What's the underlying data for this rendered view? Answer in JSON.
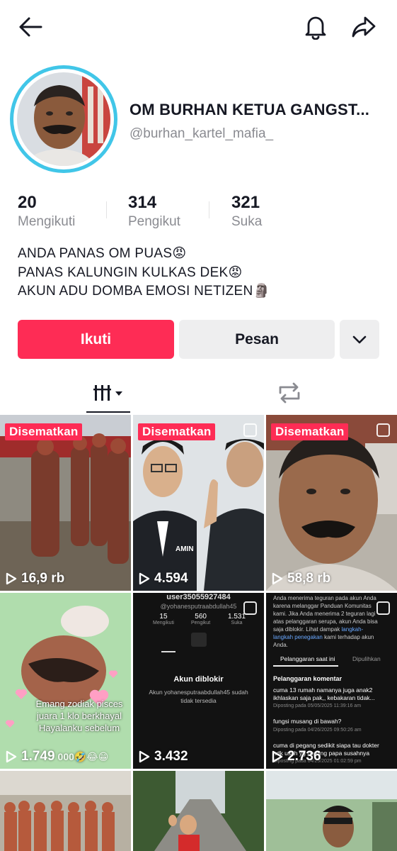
{
  "header": {
    "back_icon": "back-arrow-icon",
    "bell_icon": "bell-icon",
    "share_icon": "share-icon"
  },
  "profile": {
    "display_name": "OM BURHAN KETUA GANGST...",
    "username": "@burhan_kartel_mafia_",
    "ring_color": "#41c6e8"
  },
  "stats": [
    {
      "value": "20",
      "label": "Mengikuti"
    },
    {
      "value": "314",
      "label": "Pengikut"
    },
    {
      "value": "321",
      "label": "Suka"
    }
  ],
  "bio": [
    "ANDA PANAS OM PUAS😡",
    "PANAS KALUNGIN KULKAS DEK😡",
    "AKUN ADU DOMBA EMOSI NETIZEN🗿"
  ],
  "actions": {
    "follow_label": "Ikuti",
    "message_label": "Pesan",
    "follow_color": "#fe2c55"
  },
  "tabs": {
    "videos_icon": "grid-icon",
    "repost_icon": "repost-icon"
  },
  "videos": [
    {
      "pinned": "Disematkan",
      "views": "16,9 rb"
    },
    {
      "pinned": "Disematkan",
      "views": "4.594",
      "badge": "AMIN"
    },
    {
      "pinned": "Disematkan",
      "views": "58,8 rb"
    },
    {
      "views": "1.749",
      "caption": "Emang zodiak pisces juara 1 klo berkhayal Hayalanku sebelum",
      "caption_extra": "000🤣😂😁"
    },
    {
      "views": "3.432",
      "shot": {
        "user": "user35055927484",
        "handle": "@yohanesputraabdullah45",
        "stats": [
          {
            "v": "15",
            "l": "Mengikuti"
          },
          {
            "v": "560",
            "l": "Pengikut"
          },
          {
            "v": "1.531",
            "l": "Suka"
          }
        ],
        "blocked_title": "Akun diblokir",
        "blocked_text": "Akun yohanesputraabdullah45 sudah tidak tersedia"
      }
    },
    {
      "views": "2.736",
      "shot": {
        "warn_text": "Anda menerima teguran pada akun Anda karena melanggar Panduan Komunitas kami. Jika Anda menerima 2 teguran lagi atas pelanggaran serupa, akun Anda bisa saja diblokir. Lihat dampak",
        "warn_link": "langkah-langkah penegakan",
        "warn_tail": "kami terhadap akun Anda.",
        "tab1": "Pelanggaran saat ini",
        "tab2": "Dipulihkan",
        "section": "Pelanggaran komentar",
        "c1": "cuma 13 rumah namanya juga anak2 ikhlaskan saja pak,, kebakaran tidak...",
        "c1d": "Diposting pada 05/05/2025 11:39:16 am",
        "c2": "fungsi musang di bawah?",
        "c2d": "Diposting pada 04/26/2025 09:50:26 am",
        "c3": "cuma di pegang sedikit siapa tau dokter ndk usah yg penting papa susahnya",
        "c3d": "Diposting pada 04/25/2025 01:02:59 pm"
      }
    },
    {
      "views": ""
    },
    {
      "views": ""
    },
    {
      "views": ""
    }
  ]
}
